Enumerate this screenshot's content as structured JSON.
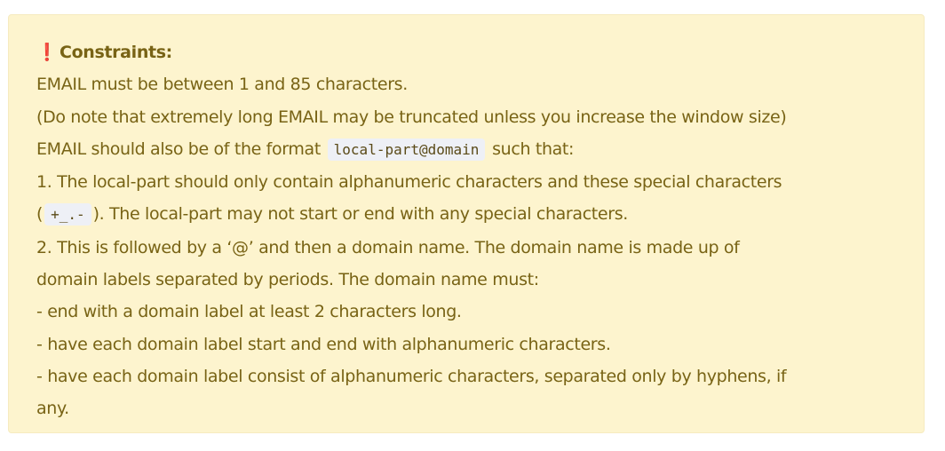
{
  "callout": {
    "icon": "❗",
    "icon_name": "exclamation-icon",
    "accent_color": "#e0303a",
    "background_color": "#fdf4ce",
    "text_color": "#786315",
    "title": "Constraints:",
    "line1": "EMAIL must be between 1 and 85 characters.",
    "line2": "(Do note that extremely long EMAIL may be truncated unless you increase the window size)",
    "line3_pre": "EMAIL should also be of the format",
    "line3_code": "local-part@domain",
    "line3_post": "such that:",
    "line4": "1. The local-part should only contain alphanumeric characters and these special characters",
    "line5_pre": "(",
    "line5_code": "+_.-",
    "line5_post": "). The local-part may not start or end with any special characters.",
    "line6": "2. This is followed by a ‘@’ and then a domain name. The domain name is made up of",
    "line7": "domain labels separated by periods. The domain name must:",
    "line8": "- end with a domain label at least 2 characters long.",
    "line9": "- have each domain label start and end with alphanumeric characters.",
    "line10": "- have each domain label consist of alphanumeric characters, separated only by hyphens, if",
    "line11": "any."
  }
}
